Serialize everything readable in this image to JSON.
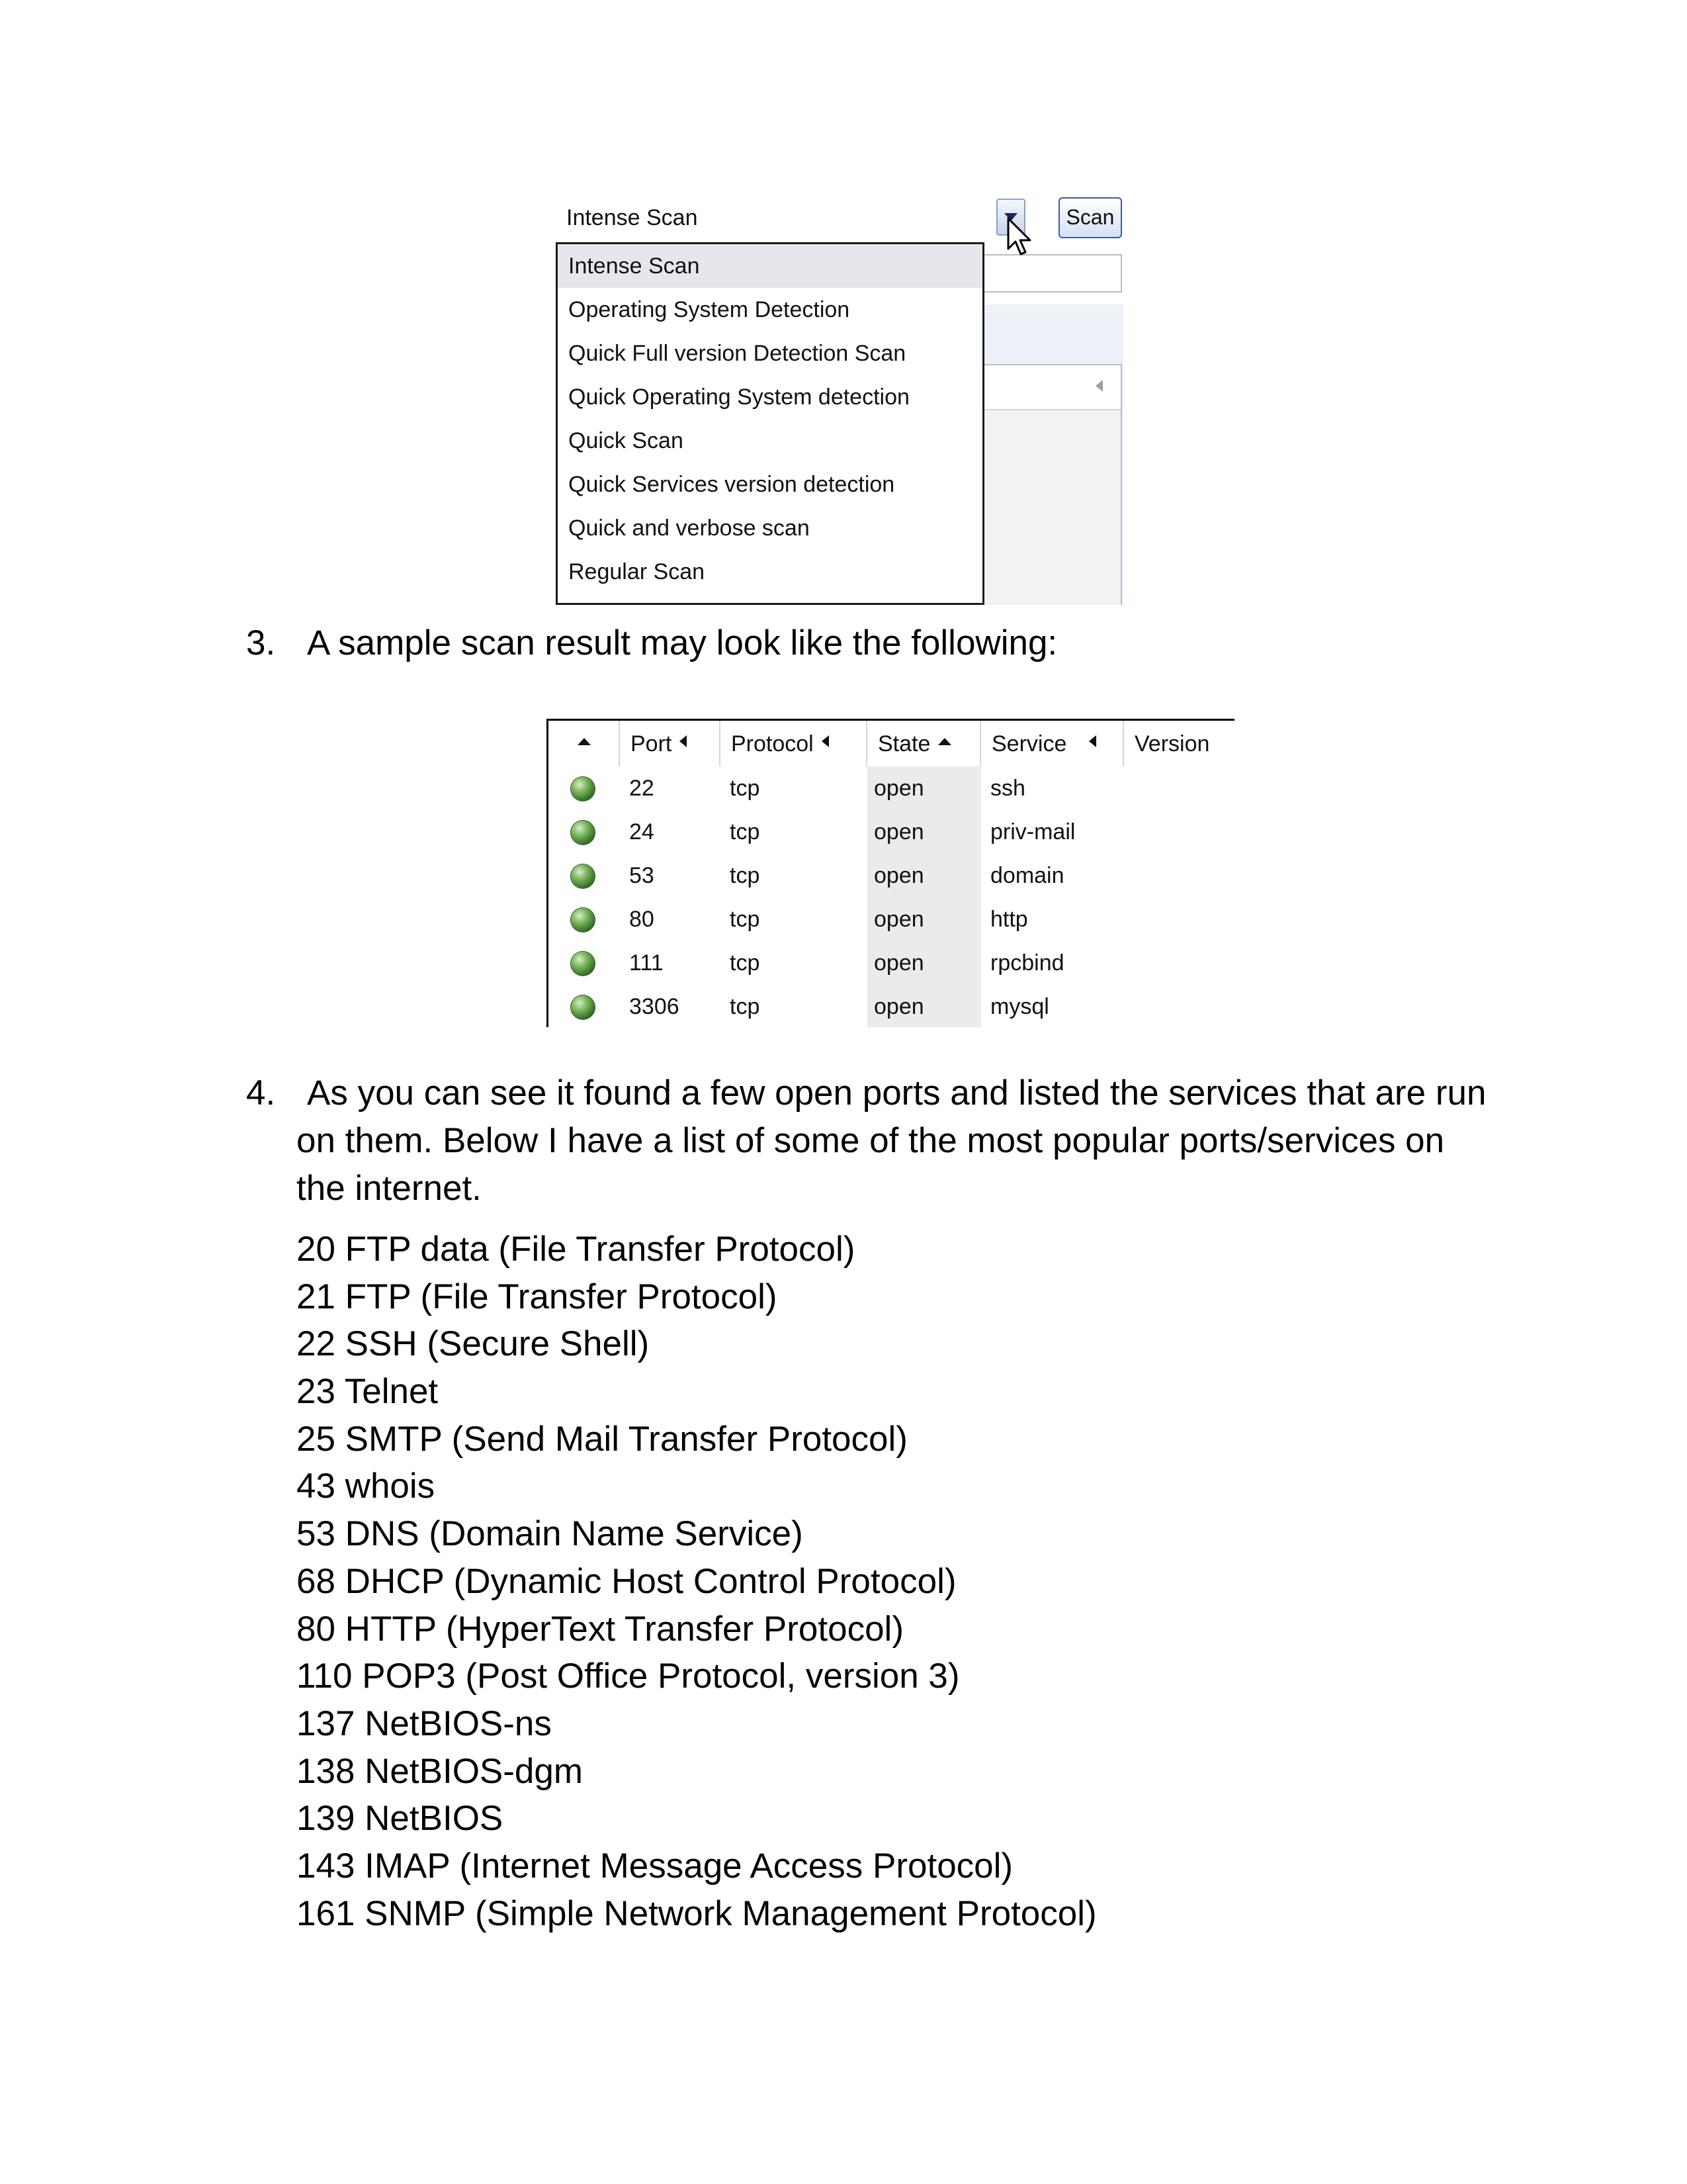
{
  "scan_profile": {
    "selected": "Intense Scan",
    "scan_button_label": "Scan",
    "options": [
      "Intense Scan",
      "Operating System Detection",
      "Quick Full version Detection Scan",
      "Quick Operating System detection",
      "Quick Scan",
      "Quick Services version detection",
      "Quick and verbose scan",
      "Regular Scan"
    ],
    "highlighted_option": "Intense Scan"
  },
  "step3": {
    "number": "3.",
    "text": "A sample scan result may look like the following:"
  },
  "results_table": {
    "columns": [
      "",
      "Port",
      "Protocol",
      "State",
      "Service",
      "Version"
    ],
    "rows": [
      {
        "status": "open-green",
        "port": "22",
        "protocol": "tcp",
        "state": "open",
        "service": "ssh",
        "version": ""
      },
      {
        "status": "open-green",
        "port": "24",
        "protocol": "tcp",
        "state": "open",
        "service": "priv-mail",
        "version": ""
      },
      {
        "status": "open-green",
        "port": "53",
        "protocol": "tcp",
        "state": "open",
        "service": "domain",
        "version": ""
      },
      {
        "status": "open-green",
        "port": "80",
        "protocol": "tcp",
        "state": "open",
        "service": "http",
        "version": ""
      },
      {
        "status": "open-green",
        "port": "111",
        "protocol": "tcp",
        "state": "open",
        "service": "rpcbind",
        "version": ""
      },
      {
        "status": "open-green",
        "port": "3306",
        "protocol": "tcp",
        "state": "open",
        "service": "mysql",
        "version": ""
      }
    ],
    "status_color": "#4a8a34"
  },
  "step4": {
    "number": "4.",
    "line1": "As you can see it found a few open ports and listed the services that are run",
    "line2": "on them. Below I have a list of some of the most popular ports/services on",
    "line3": "the internet."
  },
  "ports": [
    "20 FTP data (File Transfer Protocol)",
    "21 FTP (File Transfer Protocol)",
    "22 SSH (Secure Shell)",
    "23 Telnet",
    "25 SMTP (Send Mail Transfer Protocol)",
    "43 whois",
    "53 DNS (Domain Name Service)",
    "68 DHCP (Dynamic Host Control Protocol)",
    "80 HTTP (HyperText Transfer Protocol)",
    "110 POP3 (Post Office Protocol, version 3)",
    "137 NetBIOS-ns",
    "138 NetBIOS-dgm",
    "139 NetBIOS",
    "143 IMAP (Internet Message Access Protocol)",
    "161 SNMP (Simple Network Management Protocol)"
  ]
}
